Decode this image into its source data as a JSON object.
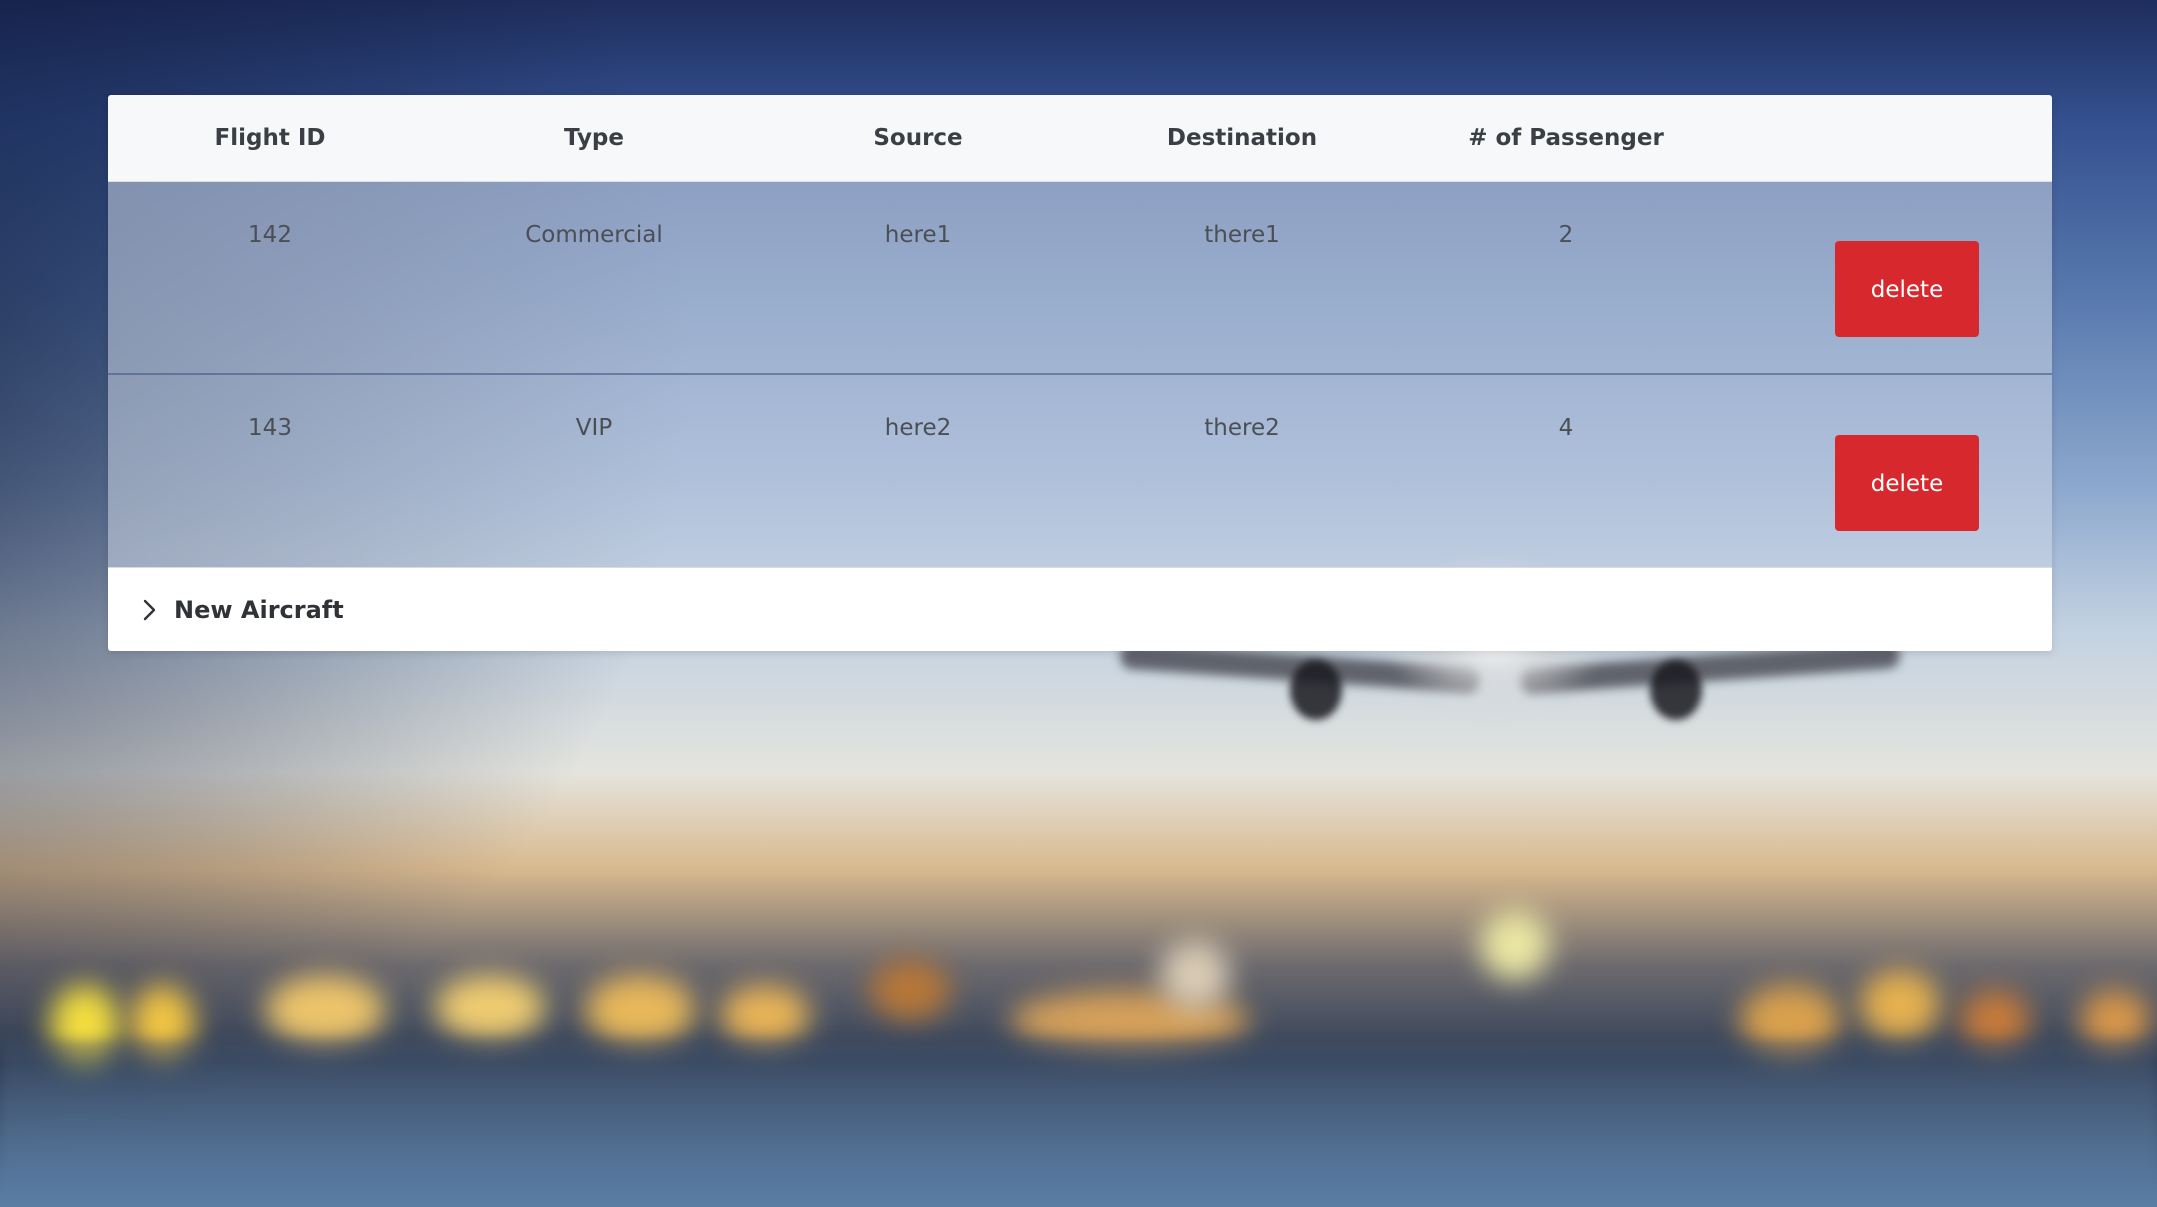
{
  "table": {
    "headers": [
      "Flight ID",
      "Type",
      "Source",
      "Destination",
      "# of Passenger",
      ""
    ],
    "rows": [
      {
        "flight_id": "142",
        "type": "Commercial",
        "source": "here1",
        "destination": "there1",
        "passengers": "2",
        "action_label": "delete"
      },
      {
        "flight_id": "143",
        "type": "VIP",
        "source": "here2",
        "destination": "there2",
        "passengers": "4",
        "action_label": "delete"
      }
    ]
  },
  "new_aircraft": {
    "label": "New Aircraft",
    "icon": "chevron-right-icon"
  },
  "colors": {
    "delete_button": "#d7282d",
    "header_background": "#f7f8fa"
  }
}
